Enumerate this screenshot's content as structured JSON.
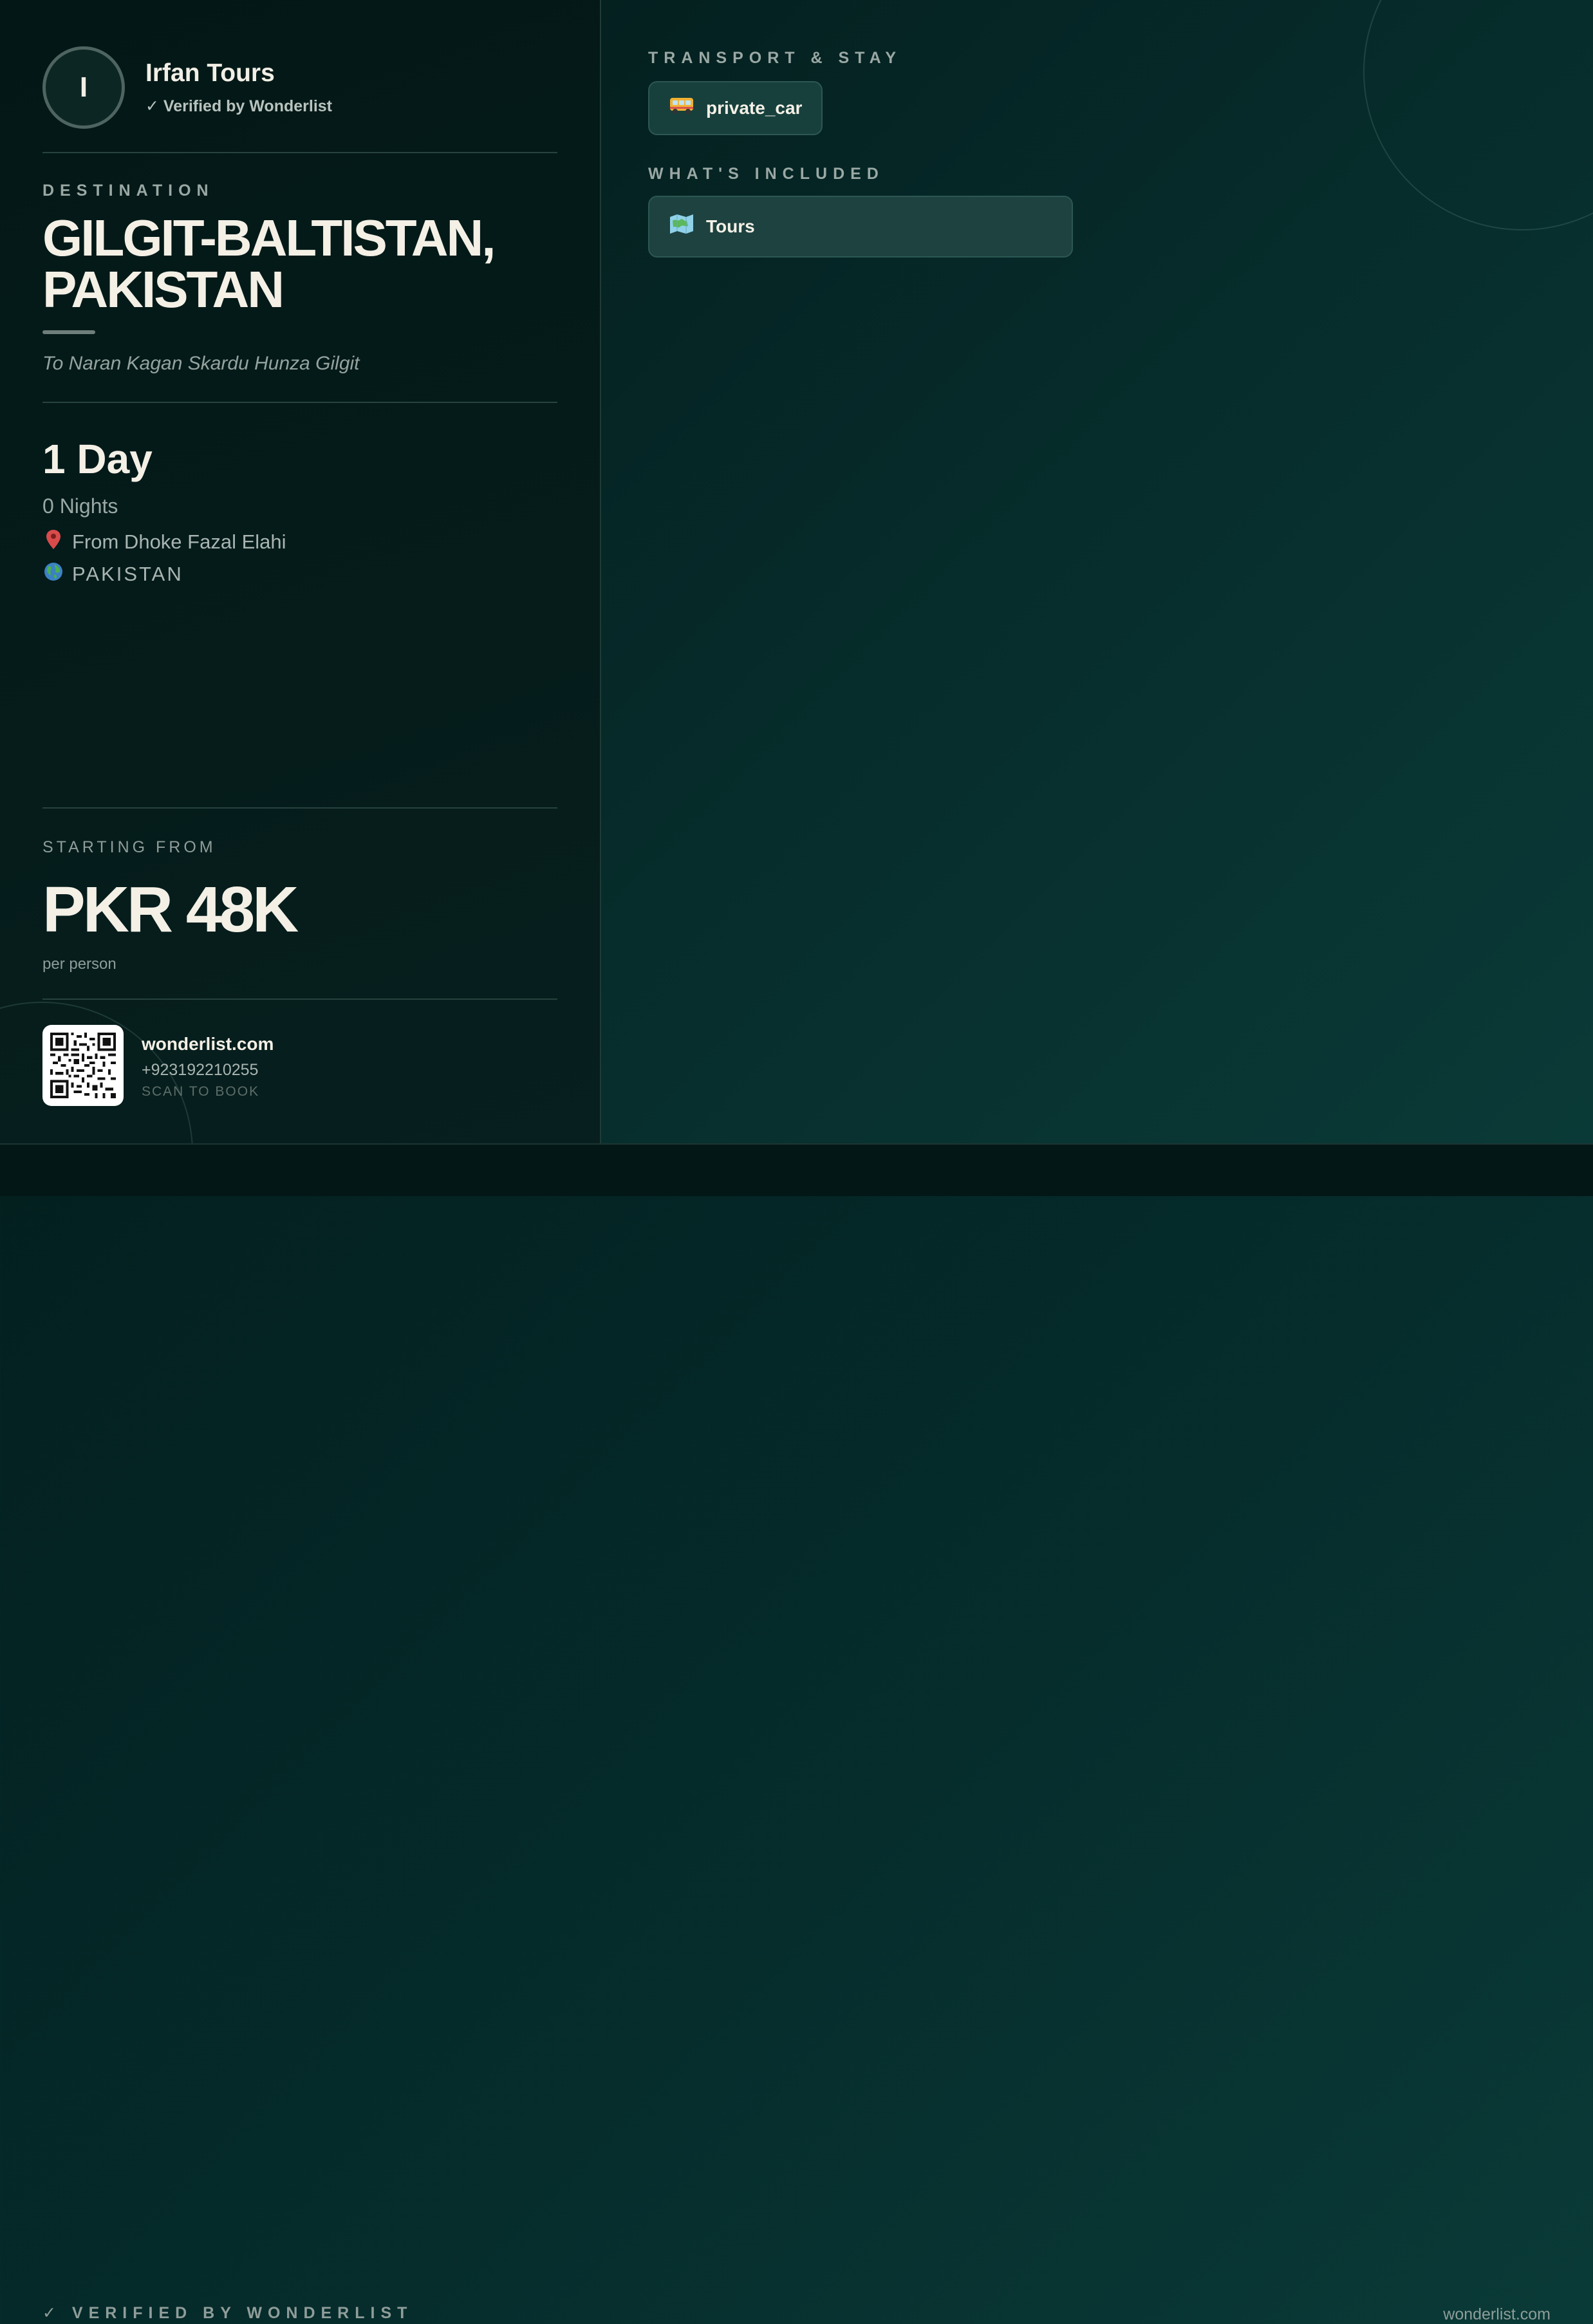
{
  "operator": {
    "initial": "I",
    "name": "Irfan Tours",
    "verified": "✓ Verified by Wonderlist"
  },
  "destination": {
    "label": "DESTINATION",
    "title": "GILGIT-BALTISTAN, PAKISTAN",
    "subtitle": "To Naran Kagan Skardu Hunza Gilgit"
  },
  "trip": {
    "duration": "1 Day",
    "nights": "0 Nights",
    "from": "From Dhoke Fazal Elahi",
    "from_icon": "map-pin-icon",
    "country": "PAKISTAN",
    "country_icon": "globe-icon"
  },
  "pricing": {
    "label": "STARTING FROM",
    "price": "PKR 48K",
    "unit": "per person"
  },
  "contact": {
    "site": "wonderlist.com",
    "phone": "+923192210255",
    "cta": "SCAN TO BOOK"
  },
  "transport": {
    "label": "TRANSPORT & STAY",
    "items": [
      {
        "label": "private_car",
        "icon": "bus-icon"
      }
    ]
  },
  "included": {
    "label": "WHAT'S INCLUDED",
    "items": [
      {
        "label": "Tours",
        "icon": "map-icon"
      }
    ]
  },
  "footer": {
    "badge": "✓ VERIFIED BY WONDERLIST",
    "site": "wonderlist.com"
  }
}
